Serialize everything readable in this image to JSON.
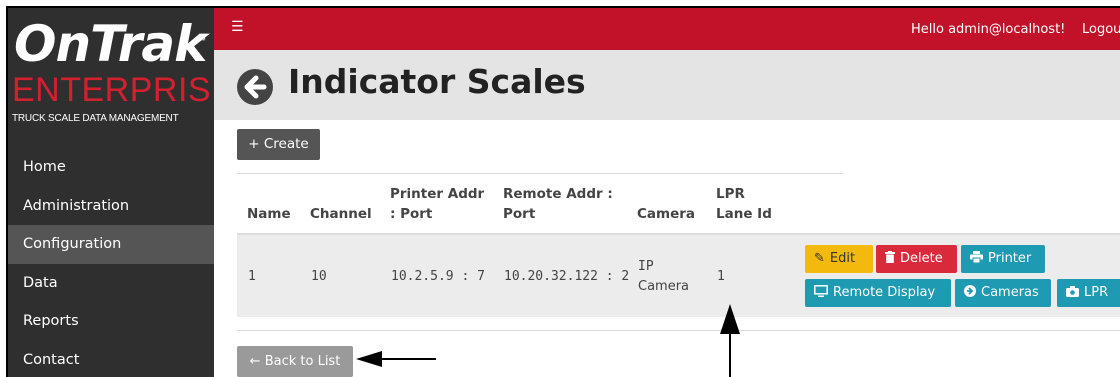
{
  "brand": {
    "name": "OnTrak",
    "trademark": "™",
    "edition": "ENTERPRISE",
    "tagline": "TRUCK SCALE DATA MANAGEMENT"
  },
  "sidebar": {
    "items": [
      {
        "label": "Home"
      },
      {
        "label": "Administration"
      },
      {
        "label": "Configuration",
        "active": true
      },
      {
        "label": "Data"
      },
      {
        "label": "Reports"
      },
      {
        "label": "Contact"
      }
    ]
  },
  "topbar": {
    "menu_icon": "hamburger-icon",
    "greeting": "Hello admin@localhost!",
    "logout": "Logou"
  },
  "header": {
    "back_icon": "arrow-left-circle-icon",
    "title": "Indicator Scales"
  },
  "toolbar": {
    "create_label": "+ Create"
  },
  "table": {
    "columns": [
      {
        "line1": "",
        "line2": "Name"
      },
      {
        "line1": "",
        "line2": "Channel"
      },
      {
        "line1": "Printer Addr",
        "line2": ": Port"
      },
      {
        "line1": "Remote Addr :",
        "line2": "Port"
      },
      {
        "line1": "",
        "line2": "Camera"
      },
      {
        "line1": "LPR",
        "line2": "Lane Id"
      }
    ],
    "rows": [
      {
        "name": "1",
        "channel": "10",
        "printer_addr": "10.2.5.9 : 7",
        "remote_addr": "10.20.32.122 : 2",
        "camera_line1": "IP",
        "camera_line2": "Camera",
        "lpr_lane_id": "1",
        "actions": {
          "edit": "Edit",
          "delete": "Delete",
          "printer": "Printer",
          "remote_display": "Remote Display",
          "cameras": "Cameras",
          "lpr": "LPR"
        }
      }
    ]
  },
  "footer": {
    "back_to_list": "← Back to List"
  },
  "colors": {
    "topbar": "#c1122a",
    "sidebar": "#2f2f2f",
    "edit": "#f3b90c",
    "delete": "#d92a3c",
    "info": "#1e9ab3"
  }
}
